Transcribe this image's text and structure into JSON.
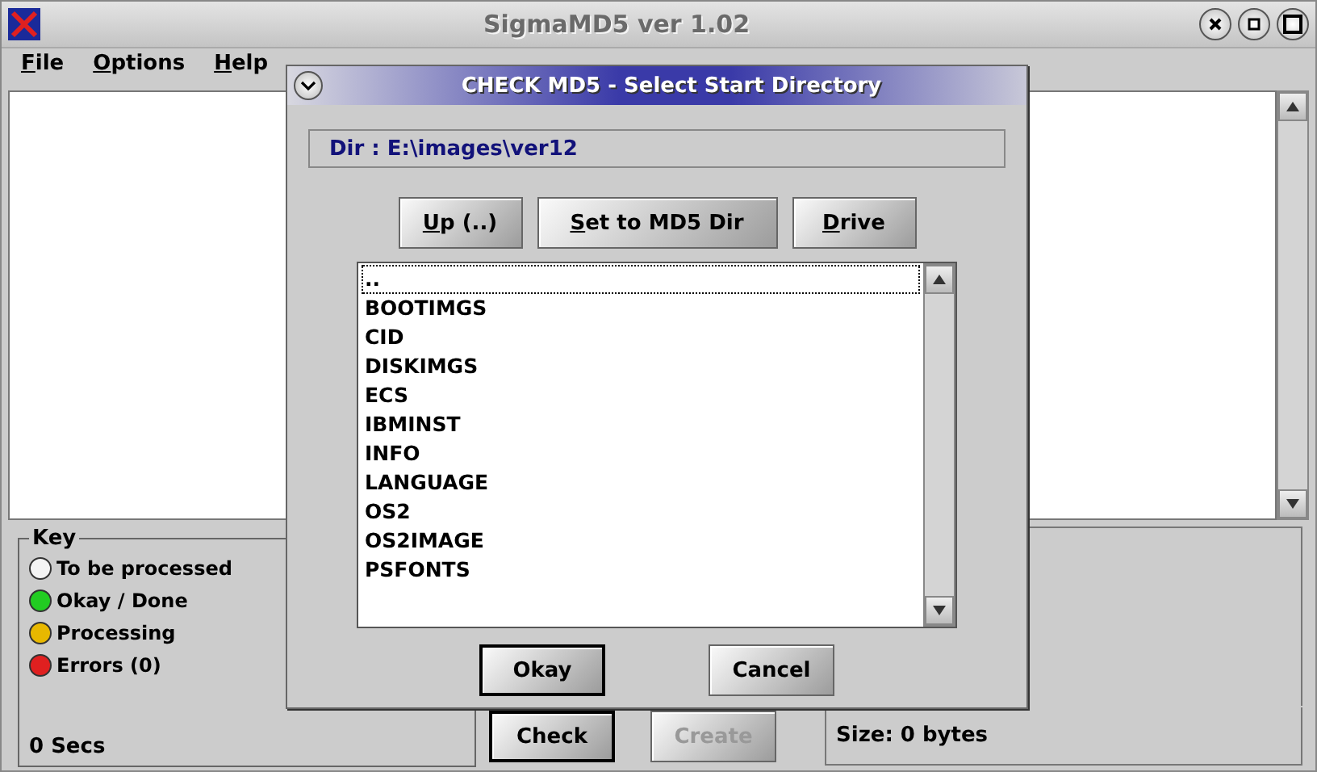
{
  "window": {
    "title": "SigmaMD5 ver 1.02"
  },
  "menu": [
    "File",
    "Options",
    "Help"
  ],
  "key": {
    "title": "Key",
    "items": [
      {
        "label": "To be processed",
        "color": "#f4f4f4"
      },
      {
        "label": "Okay / Done",
        "color": "#22cc22"
      },
      {
        "label": "Processing",
        "color": "#e8b800"
      },
      {
        "label": "Errors  (0)",
        "color": "#e02020"
      }
    ],
    "time": "0 Secs"
  },
  "buttons": [
    {
      "label": "Check",
      "disabled": false
    },
    {
      "label": "Create",
      "disabled": true
    }
  ],
  "size": "Size:  0 bytes",
  "dialog": {
    "title": "CHECK MD5 - Select Start Directory",
    "dir": "Dir :  E:\\images\\ver12",
    "buttons": [
      "Up (..)",
      "Set to MD5 Dir",
      "Drive"
    ],
    "items": [
      {
        "label": "..",
        "selected": true
      },
      {
        "label": "BOOTIMGS",
        "selected": false
      },
      {
        "label": "CID",
        "selected": false
      },
      {
        "label": "DISKIMGS",
        "selected": false
      },
      {
        "label": "ECS",
        "selected": false
      },
      {
        "label": "IBMINST",
        "selected": false
      },
      {
        "label": "INFO",
        "selected": false
      },
      {
        "label": "LANGUAGE",
        "selected": false
      },
      {
        "label": "OS2",
        "selected": false
      },
      {
        "label": "OS2IMAGE",
        "selected": false
      },
      {
        "label": "PSFONTS",
        "selected": false
      }
    ],
    "actions": [
      {
        "label": "Okay",
        "default": true
      },
      {
        "label": "Cancel",
        "default": false
      }
    ]
  }
}
